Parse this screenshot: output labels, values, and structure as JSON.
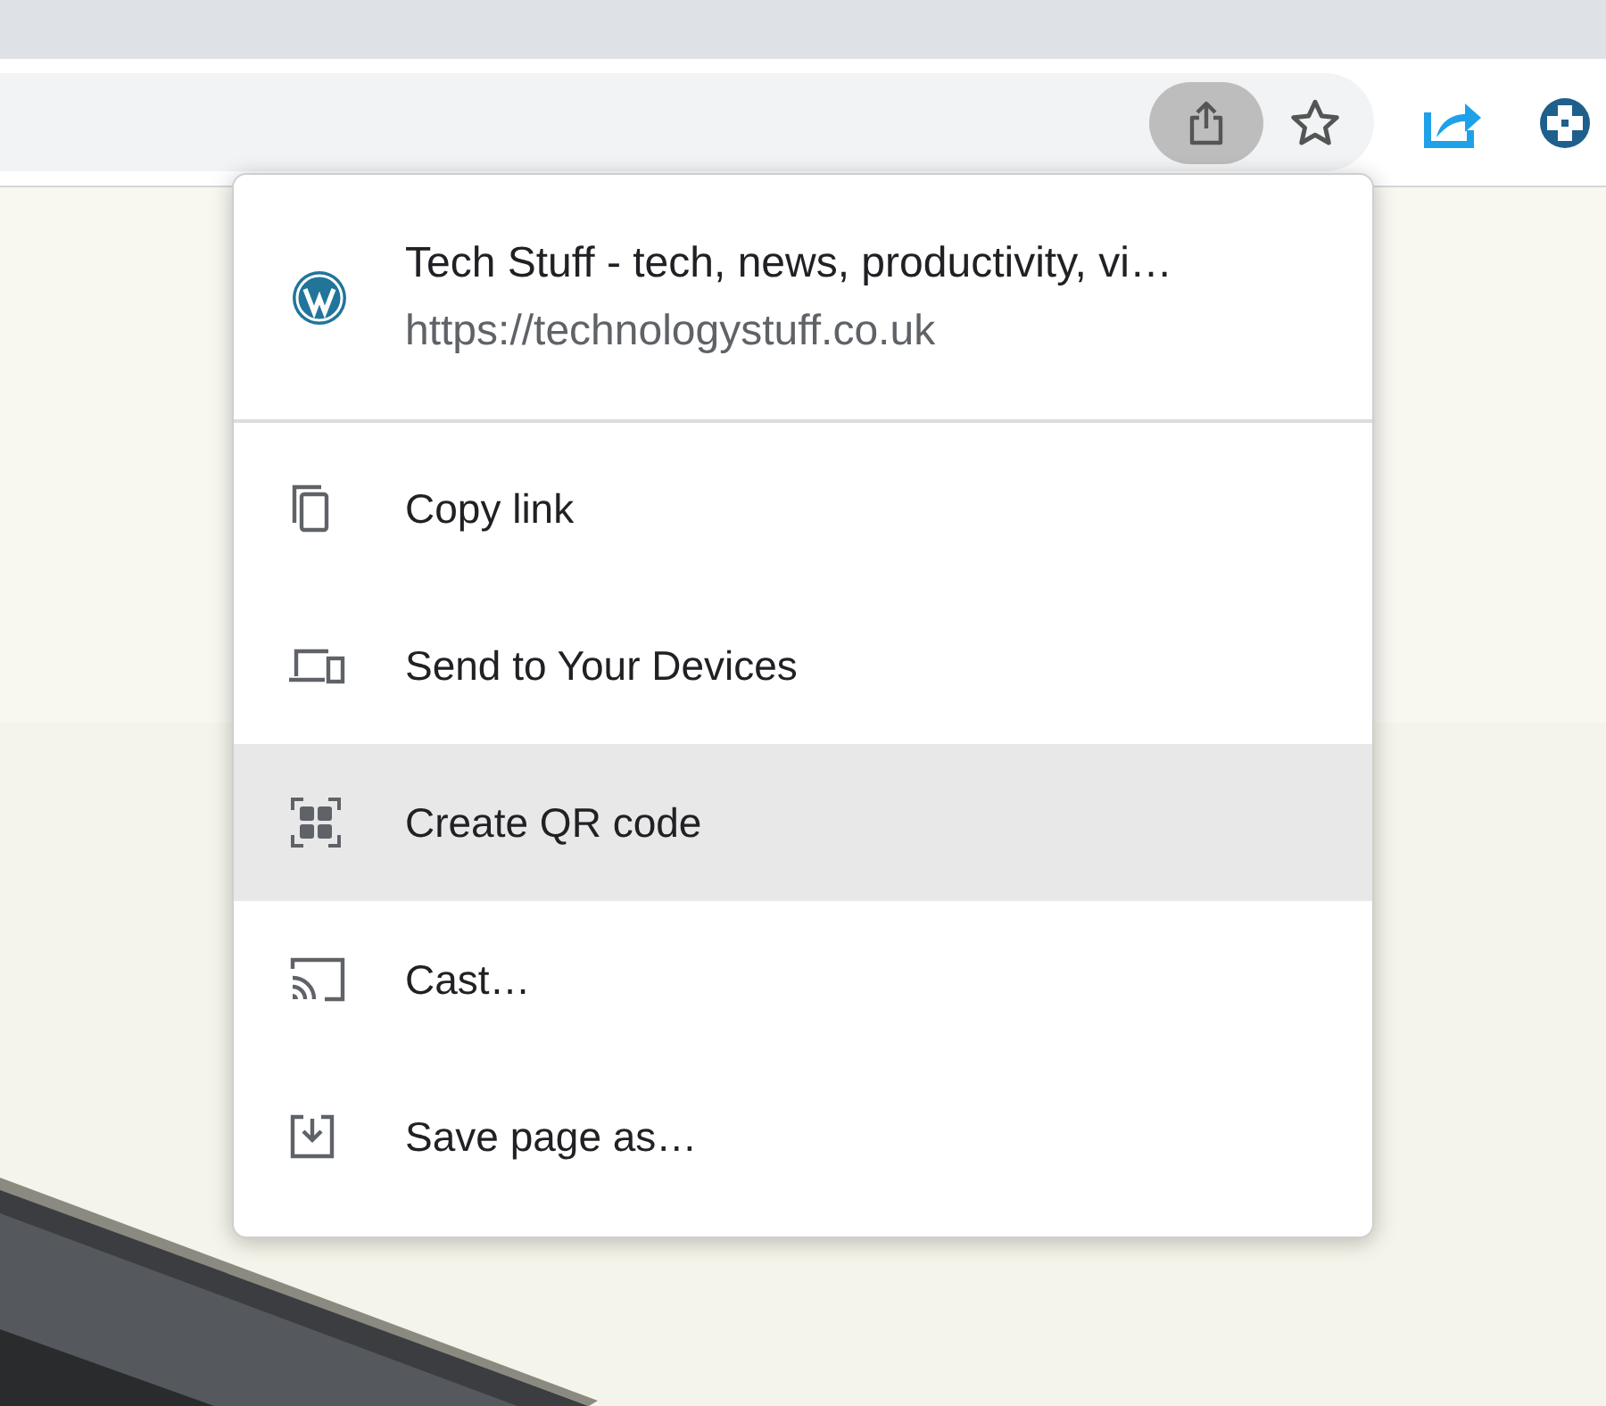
{
  "toolbar": {
    "share_button": {
      "selected": true
    }
  },
  "menu": {
    "site": {
      "title": "Tech Stuff - tech, news, productivity, vi…",
      "url": "https://technologystuff.co.uk"
    },
    "items": [
      {
        "kind": "copy",
        "label": "Copy link",
        "selected": false
      },
      {
        "kind": "devices",
        "label": "Send to Your Devices",
        "selected": false
      },
      {
        "kind": "qr",
        "label": "Create QR code",
        "selected": true
      },
      {
        "kind": "cast",
        "label": "Cast…",
        "selected": false
      },
      {
        "kind": "save",
        "label": "Save page as…",
        "selected": false
      }
    ]
  }
}
